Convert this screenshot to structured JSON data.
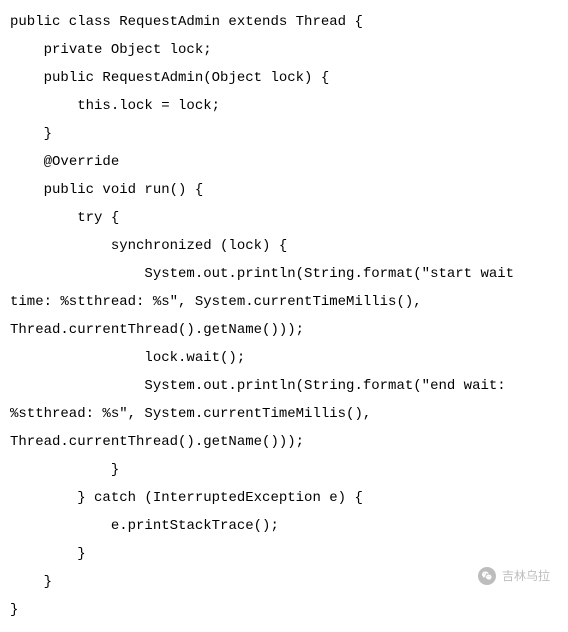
{
  "code": {
    "lines": [
      "public class RequestAdmin extends Thread {",
      "",
      "    private Object lock;",
      "",
      "    public RequestAdmin(Object lock) {",
      "        this.lock = lock;",
      "    }",
      "",
      "    @Override",
      "    public void run() {",
      "        try {",
      "            synchronized (lock) {",
      "                System.out.println(String.format(\"start wait time: %stthread: %s\", System.currentTimeMillis(), Thread.currentThread().getName()));",
      "                lock.wait();",
      "                System.out.println(String.format(\"end wait: %stthread: %s\", System.currentTimeMillis(), Thread.currentThread().getName()));",
      "            }",
      "        } catch (InterruptedException e) {",
      "            e.printStackTrace();",
      "        }",
      "    }",
      "}"
    ]
  },
  "watermark": {
    "text": "吉林乌拉"
  }
}
